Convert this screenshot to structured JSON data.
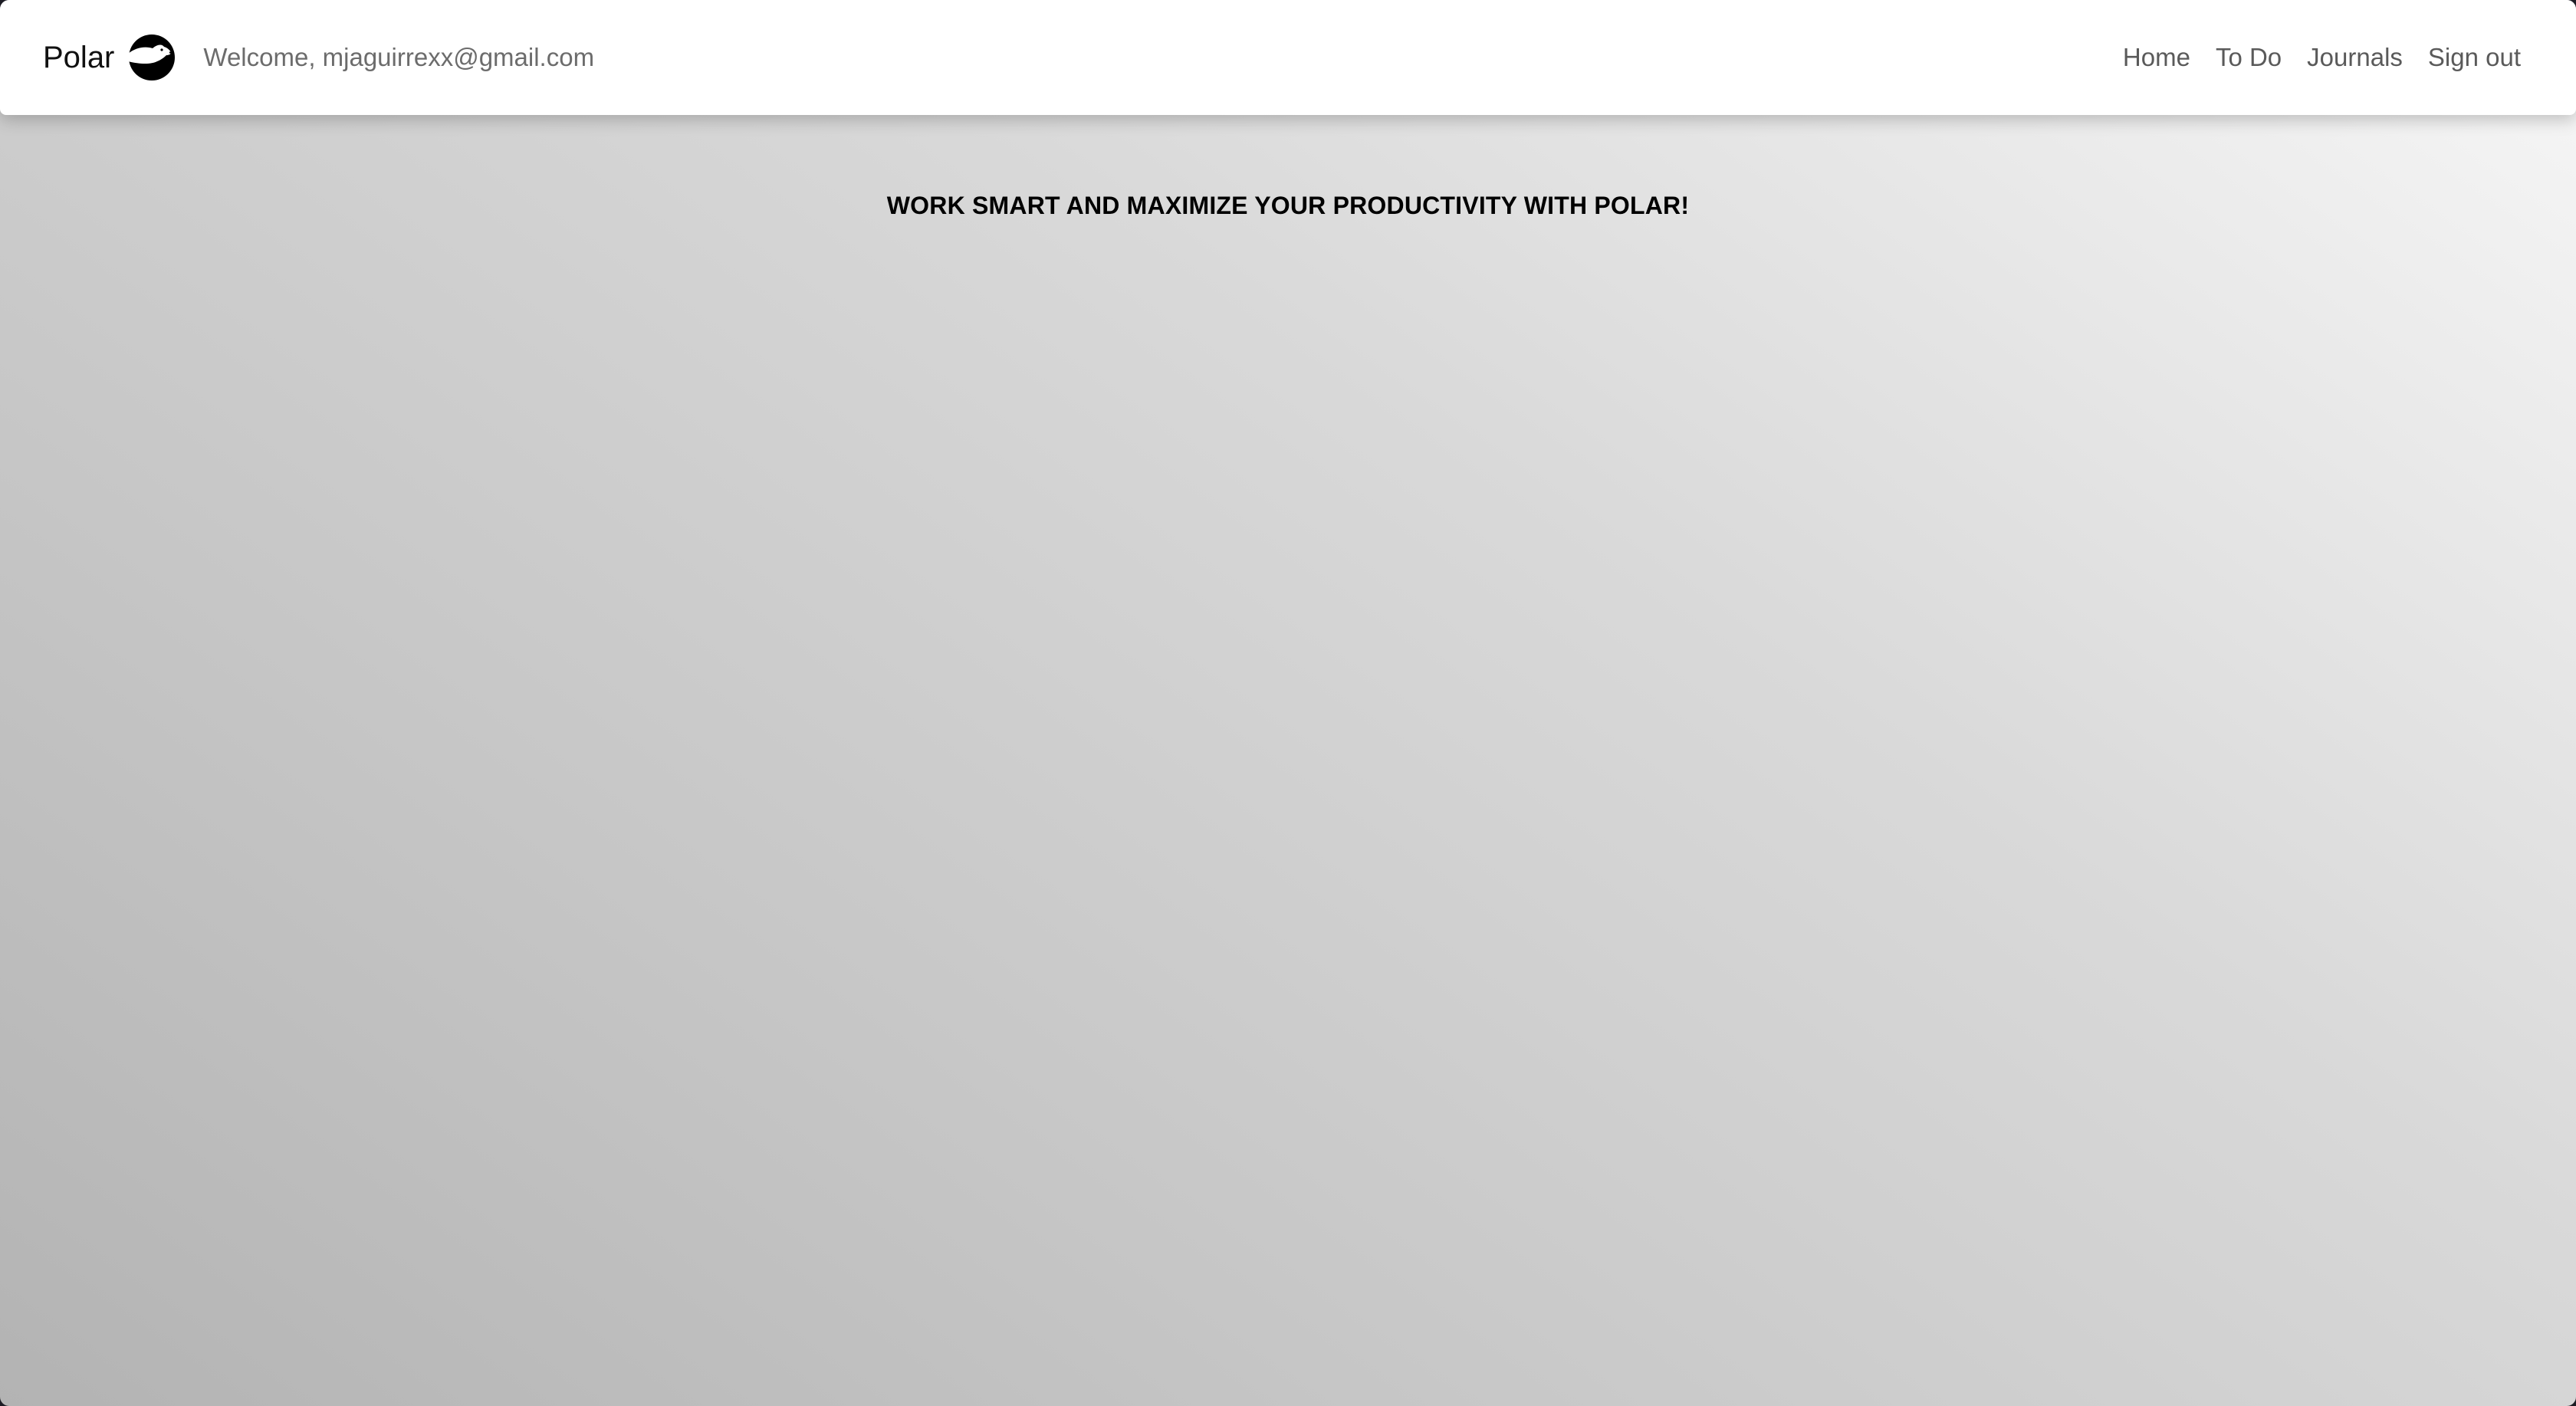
{
  "navbar": {
    "brand": "Polar",
    "welcome": "Welcome, mjaguirrexx@gmail.com",
    "links": [
      {
        "label": "Home"
      },
      {
        "label": "To Do"
      },
      {
        "label": "Journals"
      },
      {
        "label": "Sign out"
      }
    ],
    "logo_icon": "polar-bear-icon"
  },
  "main": {
    "headline": "WORK SMART AND MAXIMIZE YOUR PRODUCTIVITY WITH POLAR!"
  },
  "colors": {
    "navbar_bg": "#ffffff",
    "link_text": "#5a5a5a",
    "welcome_text": "#6c6c6c",
    "headline_text": "#000000",
    "gradient_dark": "#b3b3b3",
    "gradient_light": "#f7f7f7"
  }
}
